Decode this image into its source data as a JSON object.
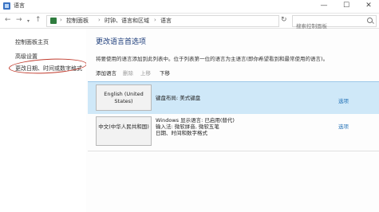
{
  "window": {
    "title": "语言",
    "controls": {
      "minimize": "—",
      "maximize": "☐",
      "close": "✕"
    }
  },
  "addressbar": {
    "back": "←",
    "forward": "→",
    "up": "↑",
    "breadcrumbs": [
      "控制面板",
      "时钟、语言和区域",
      "语言"
    ],
    "refresh": "↻",
    "search_placeholder": "搜索控制面板"
  },
  "sidebar": {
    "items": [
      {
        "label": "控制面板主页"
      },
      {
        "label": "高级设置"
      },
      {
        "label": "更改日期、时间或数字格式"
      }
    ]
  },
  "main": {
    "title": "更改语言首选项",
    "description": "将要使用的语言添加到此列表中。位于列表第一位的语言为主语言(即你希望看到和最常使用的语言)。",
    "toolbar": {
      "add": "添加语言",
      "remove": "删除",
      "up": "上移",
      "down": "下移"
    },
    "languages": [
      {
        "name": "English (United States)",
        "info": [
          "键盘布局: 美式键盘"
        ],
        "options": "选项",
        "selected": true
      },
      {
        "name": "中文(中华人民共和国)",
        "info": [
          "Windows 显示语言: 已启用(替代)",
          "输入法: 微软拼音, 微软五笔",
          "日期、时间和数字格式"
        ],
        "options": "选项",
        "selected": false
      }
    ]
  },
  "colors": {
    "selected_row": "#cfe8f8",
    "link": "#1f6fb5",
    "heading": "#1c3c7a",
    "annotation": "#c0392b"
  }
}
